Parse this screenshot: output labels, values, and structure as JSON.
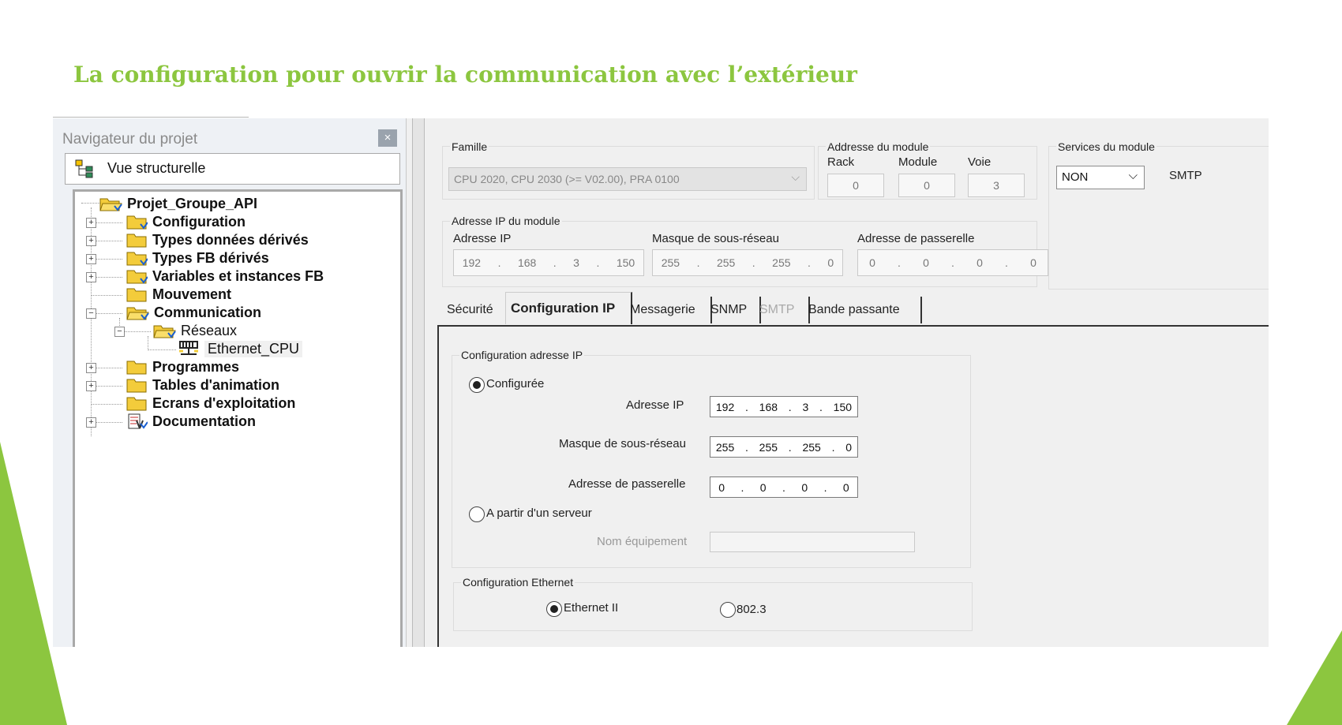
{
  "slide": {
    "title": "La configuration pour ouvrir la communication avec l’extérieur"
  },
  "navigator": {
    "title": "Navigateur du projet",
    "close": "×",
    "view_label": "Vue structurelle",
    "tree": [
      {
        "label": "Projet_Groupe_API",
        "icon": "folder-open-icon"
      },
      {
        "label": "Configuration",
        "icon": "folder-icon",
        "expander": "+"
      },
      {
        "label": "Types données dérivés",
        "icon": "folder-icon",
        "expander": "+"
      },
      {
        "label": "Types FB dérivés",
        "icon": "folder-icon",
        "expander": "+"
      },
      {
        "label": "Variables et instances FB",
        "icon": "folder-icon",
        "expander": "+"
      },
      {
        "label": "Mouvement",
        "icon": "folder-icon"
      },
      {
        "label": "Communication",
        "icon": "folder-open-icon",
        "expander": "−"
      },
      {
        "label": "Réseaux",
        "icon": "folder-open-icon",
        "expander": "−"
      },
      {
        "label": "Ethernet_CPU",
        "icon": "network-icon"
      },
      {
        "label": "Programmes",
        "icon": "folder-icon",
        "expander": "+"
      },
      {
        "label": "Tables d'animation",
        "icon": "folder-icon",
        "expander": "+"
      },
      {
        "label": "Ecrans d'exploitation",
        "icon": "folder-icon"
      },
      {
        "label": "Documentation",
        "icon": "documentation-icon",
        "expander": "+"
      }
    ]
  },
  "module": {
    "famille_label": "Famille",
    "famille_value": "CPU 2020, CPU 2030 (>= V02.00), PRA 0100",
    "address_label": "Addresse du module",
    "rack_label": "Rack",
    "rack_value": "0",
    "module_label": "Module",
    "module_value": "0",
    "voie_label": "Voie",
    "voie_value": "3",
    "services_label": "Services du module",
    "services_value": "NON",
    "smtp_label": "SMTP",
    "ip_group_label": "Adresse IP du module",
    "ip_label": "Adresse IP",
    "ip": [
      "192",
      "168",
      "3",
      "150"
    ],
    "mask_label": "Masque de sous-réseau",
    "mask": [
      "255",
      "255",
      "255",
      "0"
    ],
    "gateway_label": "Adresse de passerelle",
    "gateway": [
      "0",
      "0",
      "0",
      "0"
    ]
  },
  "tabs": [
    "Sécurité",
    "Configuration IP",
    "Messagerie",
    "SNMP",
    "SMTP",
    "Bande passante"
  ],
  "ip_config": {
    "group_label": "Configuration adresse IP",
    "configured_label": "Configurée",
    "ip_label": "Adresse IP",
    "ip": [
      "192",
      "168",
      "3",
      "150"
    ],
    "mask_label": "Masque de sous-réseau",
    "mask": [
      "255",
      "255",
      "255",
      "0"
    ],
    "gateway_label": "Adresse de passerelle",
    "gateway": [
      "0",
      "0",
      "0",
      "0"
    ],
    "server_label": "A partir d'un serveur",
    "device_name_label": "Nom équipement",
    "device_name_value": ""
  },
  "ethernet_config": {
    "group_label": "Configuration Ethernet",
    "option1": "Ethernet II",
    "option2": "802.3"
  },
  "colors": {
    "accent_green": "#8cc63f"
  }
}
